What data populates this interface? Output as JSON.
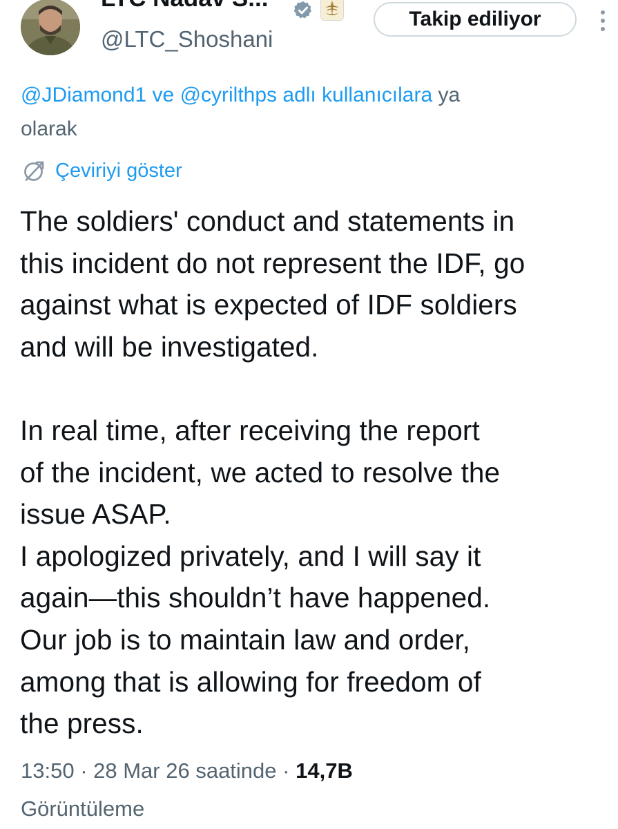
{
  "header": {
    "display_name": "LTC Nadav S...",
    "handle": "@LTC_Shoshani",
    "follow_button_label": "Takip ediliyor",
    "avatar_icon": "profile-photo-soldier",
    "verified_icon": "verified-badge-icon",
    "affiliate_icon": "idf-emblem-icon",
    "more_icon": "vertical-ellipsis-icon"
  },
  "reply_context": {
    "mention_1": "@JDiamond1",
    "joiner": " ve ",
    "mention_2": "@cyrilthps",
    "suffix": " adlı kullanıcılara",
    "tail": " ya",
    "line2": "olarak"
  },
  "translate": {
    "label": "Çeviriyi göster",
    "icon": "globe-translate-icon"
  },
  "tweet": {
    "paragraph_1": [
      "The soldiers' conduct and statements in",
      "this incident do not represent the IDF, go",
      "against what is expected of IDF soldiers",
      "and will be investigated."
    ],
    "paragraph_2": [
      "In real time, after receiving the report",
      "of the incident, we acted to resolve the",
      "issue ASAP.",
      "I apologized privately, and I will say it",
      "again—this shouldn’t have happened.",
      "Our job is to maintain law and order,",
      "among that is allowing for freedom of",
      "the press."
    ]
  },
  "meta": {
    "time": "13:50",
    "separator": " · ",
    "date": "28 Mar 26 saatinde",
    "views_count": "14,7B",
    "views_label": "Görüntüleme"
  },
  "colors": {
    "accent": "#1d9bf0",
    "text_primary": "#0f1419",
    "text_secondary": "#536471",
    "button_border": "#cfd9de"
  }
}
